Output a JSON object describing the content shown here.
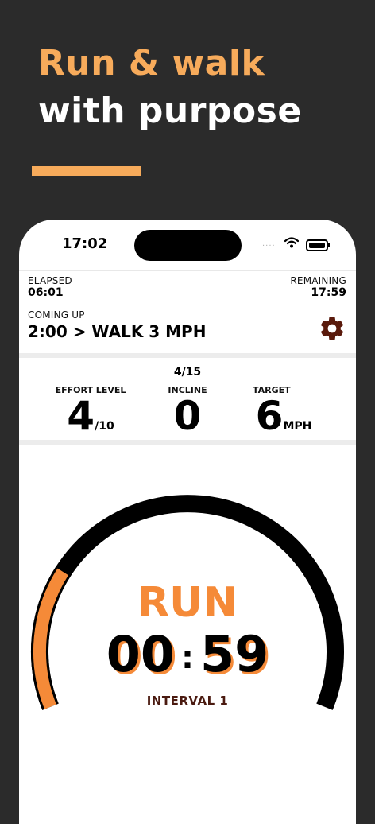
{
  "headline": {
    "line1": "Run & walk",
    "line2": "with purpose"
  },
  "colors": {
    "accent": "#f7ab5b",
    "run": "#f58a38",
    "background": "#2b2b2b",
    "interval": "#4a1a10"
  },
  "status_bar": {
    "time": "17:02",
    "signal": "····",
    "icons": [
      "wifi-icon",
      "battery-icon"
    ]
  },
  "workout": {
    "elapsed_label": "ELAPSED",
    "elapsed_value": "06:01",
    "remaining_label": "REMAINING",
    "remaining_value": "17:59",
    "coming_up_label": "COMING UP",
    "coming_up_value": "2:00 > WALK 3 MPH",
    "settings_icon": "gear-icon"
  },
  "stats": {
    "count": "4/15",
    "effort_label": "EFFORT LEVEL",
    "effort_value": "4",
    "effort_unit": "/10",
    "incline_label": "INCLINE",
    "incline_value": "0",
    "target_label": "TARGET",
    "target_value": "6",
    "target_unit": "MPH"
  },
  "timer": {
    "mode": "RUN",
    "minutes": "00",
    "separator": ":",
    "seconds": "59",
    "interval_label": "INTERVAL 1",
    "progress": 0.22
  }
}
